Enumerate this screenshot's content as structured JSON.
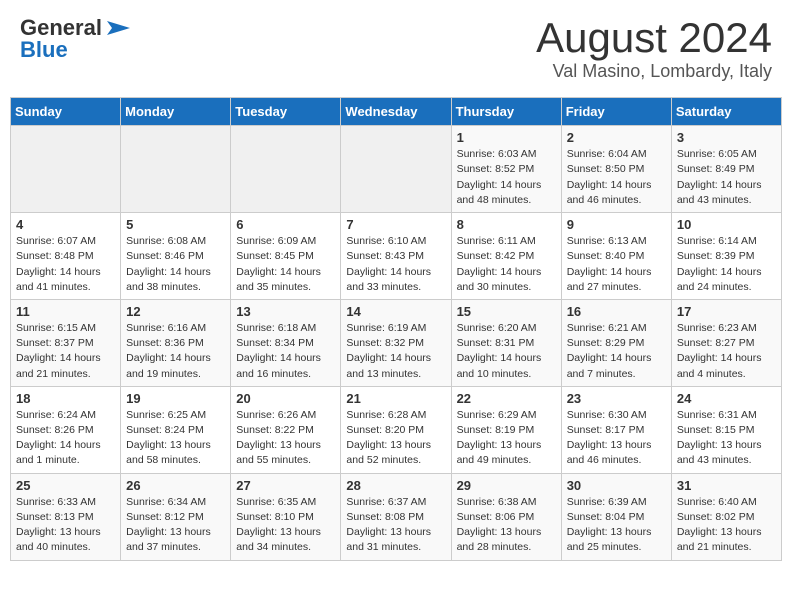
{
  "header": {
    "logo_general": "General",
    "logo_blue": "Blue",
    "month_title": "August 2024",
    "location": "Val Masino, Lombardy, Italy"
  },
  "days_of_week": [
    "Sunday",
    "Monday",
    "Tuesday",
    "Wednesday",
    "Thursday",
    "Friday",
    "Saturday"
  ],
  "weeks": [
    [
      {
        "day": "",
        "info": ""
      },
      {
        "day": "",
        "info": ""
      },
      {
        "day": "",
        "info": ""
      },
      {
        "day": "",
        "info": ""
      },
      {
        "day": "1",
        "info": "Sunrise: 6:03 AM\nSunset: 8:52 PM\nDaylight: 14 hours and 48 minutes."
      },
      {
        "day": "2",
        "info": "Sunrise: 6:04 AM\nSunset: 8:50 PM\nDaylight: 14 hours and 46 minutes."
      },
      {
        "day": "3",
        "info": "Sunrise: 6:05 AM\nSunset: 8:49 PM\nDaylight: 14 hours and 43 minutes."
      }
    ],
    [
      {
        "day": "4",
        "info": "Sunrise: 6:07 AM\nSunset: 8:48 PM\nDaylight: 14 hours and 41 minutes."
      },
      {
        "day": "5",
        "info": "Sunrise: 6:08 AM\nSunset: 8:46 PM\nDaylight: 14 hours and 38 minutes."
      },
      {
        "day": "6",
        "info": "Sunrise: 6:09 AM\nSunset: 8:45 PM\nDaylight: 14 hours and 35 minutes."
      },
      {
        "day": "7",
        "info": "Sunrise: 6:10 AM\nSunset: 8:43 PM\nDaylight: 14 hours and 33 minutes."
      },
      {
        "day": "8",
        "info": "Sunrise: 6:11 AM\nSunset: 8:42 PM\nDaylight: 14 hours and 30 minutes."
      },
      {
        "day": "9",
        "info": "Sunrise: 6:13 AM\nSunset: 8:40 PM\nDaylight: 14 hours and 27 minutes."
      },
      {
        "day": "10",
        "info": "Sunrise: 6:14 AM\nSunset: 8:39 PM\nDaylight: 14 hours and 24 minutes."
      }
    ],
    [
      {
        "day": "11",
        "info": "Sunrise: 6:15 AM\nSunset: 8:37 PM\nDaylight: 14 hours and 21 minutes."
      },
      {
        "day": "12",
        "info": "Sunrise: 6:16 AM\nSunset: 8:36 PM\nDaylight: 14 hours and 19 minutes."
      },
      {
        "day": "13",
        "info": "Sunrise: 6:18 AM\nSunset: 8:34 PM\nDaylight: 14 hours and 16 minutes."
      },
      {
        "day": "14",
        "info": "Sunrise: 6:19 AM\nSunset: 8:32 PM\nDaylight: 14 hours and 13 minutes."
      },
      {
        "day": "15",
        "info": "Sunrise: 6:20 AM\nSunset: 8:31 PM\nDaylight: 14 hours and 10 minutes."
      },
      {
        "day": "16",
        "info": "Sunrise: 6:21 AM\nSunset: 8:29 PM\nDaylight: 14 hours and 7 minutes."
      },
      {
        "day": "17",
        "info": "Sunrise: 6:23 AM\nSunset: 8:27 PM\nDaylight: 14 hours and 4 minutes."
      }
    ],
    [
      {
        "day": "18",
        "info": "Sunrise: 6:24 AM\nSunset: 8:26 PM\nDaylight: 14 hours and 1 minute."
      },
      {
        "day": "19",
        "info": "Sunrise: 6:25 AM\nSunset: 8:24 PM\nDaylight: 13 hours and 58 minutes."
      },
      {
        "day": "20",
        "info": "Sunrise: 6:26 AM\nSunset: 8:22 PM\nDaylight: 13 hours and 55 minutes."
      },
      {
        "day": "21",
        "info": "Sunrise: 6:28 AM\nSunset: 8:20 PM\nDaylight: 13 hours and 52 minutes."
      },
      {
        "day": "22",
        "info": "Sunrise: 6:29 AM\nSunset: 8:19 PM\nDaylight: 13 hours and 49 minutes."
      },
      {
        "day": "23",
        "info": "Sunrise: 6:30 AM\nSunset: 8:17 PM\nDaylight: 13 hours and 46 minutes."
      },
      {
        "day": "24",
        "info": "Sunrise: 6:31 AM\nSunset: 8:15 PM\nDaylight: 13 hours and 43 minutes."
      }
    ],
    [
      {
        "day": "25",
        "info": "Sunrise: 6:33 AM\nSunset: 8:13 PM\nDaylight: 13 hours and 40 minutes."
      },
      {
        "day": "26",
        "info": "Sunrise: 6:34 AM\nSunset: 8:12 PM\nDaylight: 13 hours and 37 minutes."
      },
      {
        "day": "27",
        "info": "Sunrise: 6:35 AM\nSunset: 8:10 PM\nDaylight: 13 hours and 34 minutes."
      },
      {
        "day": "28",
        "info": "Sunrise: 6:37 AM\nSunset: 8:08 PM\nDaylight: 13 hours and 31 minutes."
      },
      {
        "day": "29",
        "info": "Sunrise: 6:38 AM\nSunset: 8:06 PM\nDaylight: 13 hours and 28 minutes."
      },
      {
        "day": "30",
        "info": "Sunrise: 6:39 AM\nSunset: 8:04 PM\nDaylight: 13 hours and 25 minutes."
      },
      {
        "day": "31",
        "info": "Sunrise: 6:40 AM\nSunset: 8:02 PM\nDaylight: 13 hours and 21 minutes."
      }
    ]
  ]
}
